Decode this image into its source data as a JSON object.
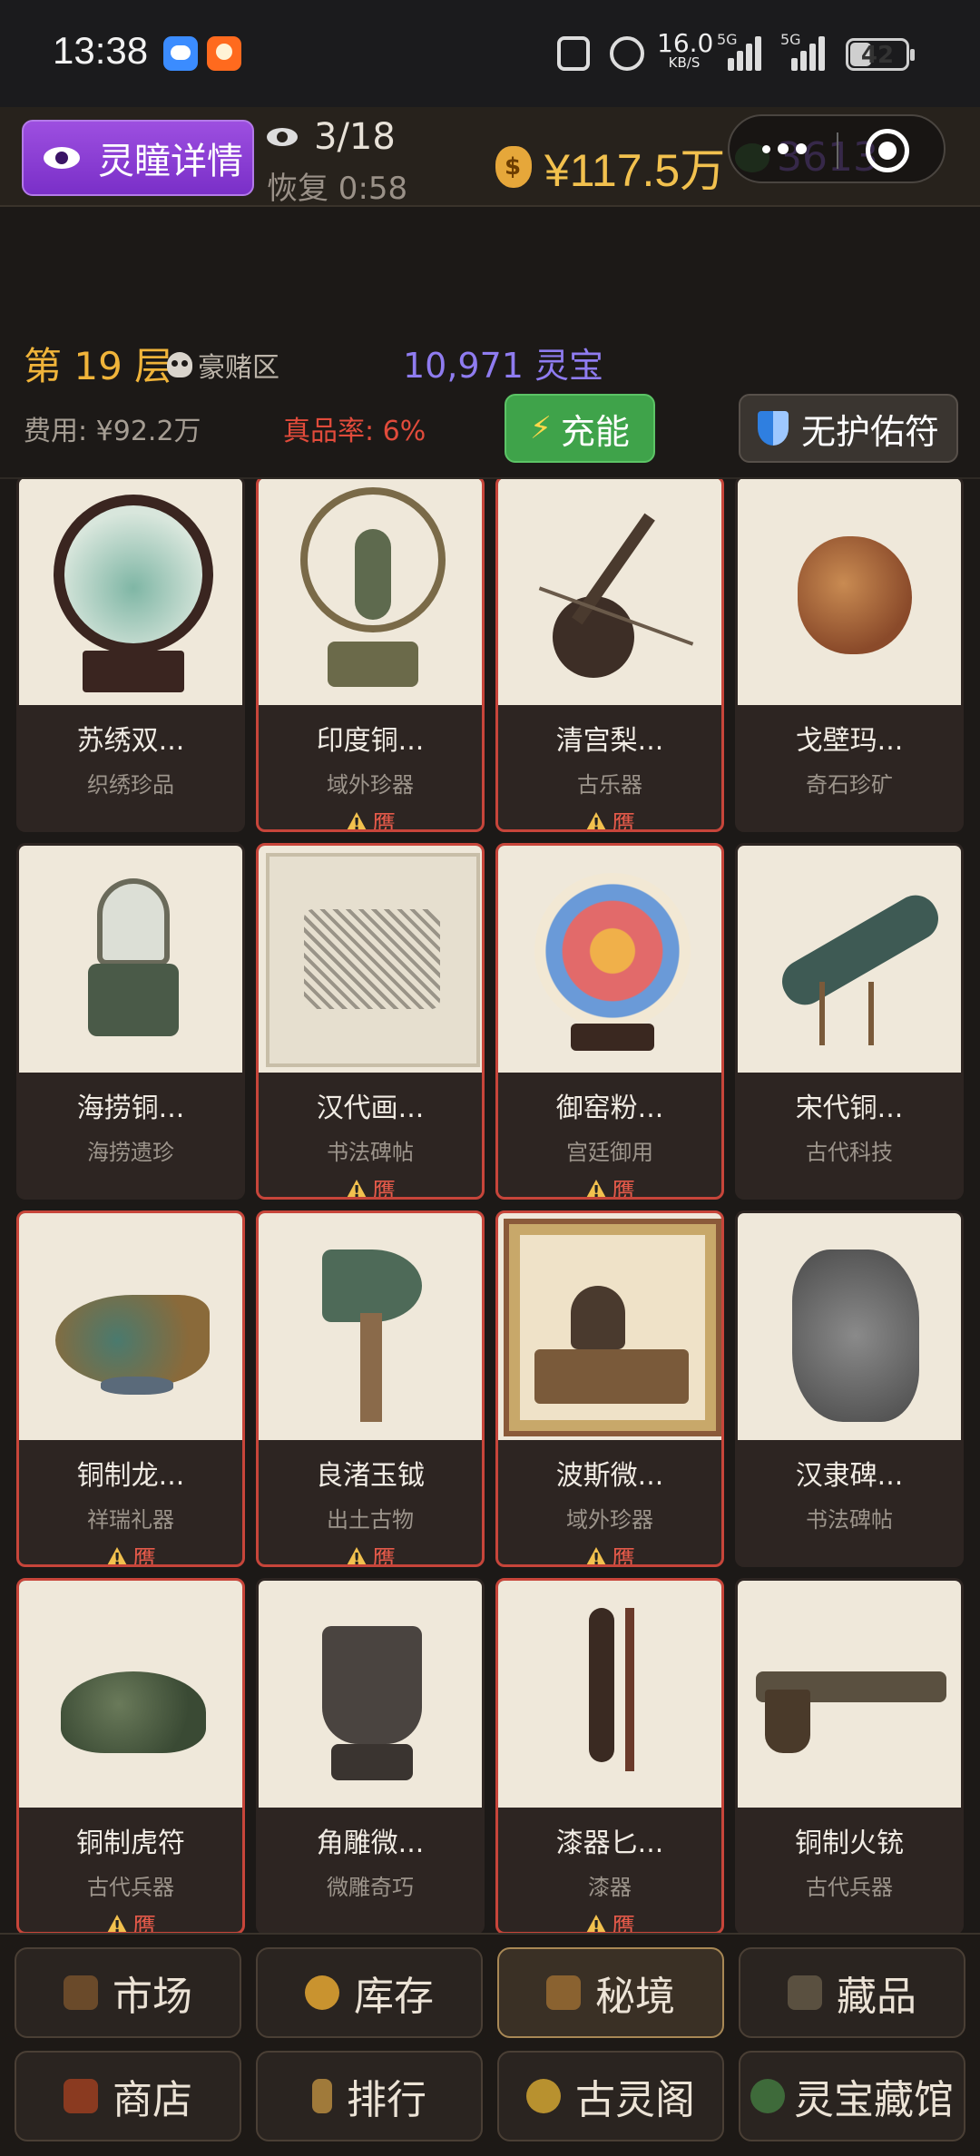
{
  "status_bar": {
    "time": "13:38",
    "net_speed_value": "16.0",
    "net_speed_unit": "KB/S",
    "signal1_tag": "5G",
    "signal2_tag": "5G",
    "battery": "42"
  },
  "header": {
    "eye_button_label": "灵瞳详情",
    "eye_count": "3/18",
    "recover_text": "恢复 0:58",
    "money": "¥117.5万",
    "gems": "3613"
  },
  "floor": {
    "floor_label": "第 19 层",
    "zone": "豪赌区",
    "lingbao": "10,971 灵宝",
    "cost": "费用: ¥92.2万",
    "rate": "真品率: 6%",
    "charge_label": "充能",
    "protect_label": "无护佑符"
  },
  "items": [
    {
      "name": "苏绣双...",
      "category": "织绣珍品",
      "fake": false,
      "warn": ""
    },
    {
      "name": "印度铜...",
      "category": "域外珍器",
      "fake": true,
      "warn": "赝"
    },
    {
      "name": "清宫梨...",
      "category": "古乐器",
      "fake": true,
      "warn": "赝"
    },
    {
      "name": "戈壁玛...",
      "category": "奇石珍矿",
      "fake": false,
      "warn": ""
    },
    {
      "name": "海捞铜...",
      "category": "海捞遗珍",
      "fake": false,
      "warn": ""
    },
    {
      "name": "汉代画...",
      "category": "书法碑帖",
      "fake": true,
      "warn": "赝"
    },
    {
      "name": "御窑粉...",
      "category": "宫廷御用",
      "fake": true,
      "warn": "赝"
    },
    {
      "name": "宋代铜...",
      "category": "古代科技",
      "fake": false,
      "warn": ""
    },
    {
      "name": "铜制龙...",
      "category": "祥瑞礼器",
      "fake": true,
      "warn": "赝"
    },
    {
      "name": "良渚玉钺",
      "category": "出土古物",
      "fake": true,
      "warn": "赝"
    },
    {
      "name": "波斯微...",
      "category": "域外珍器",
      "fake": true,
      "warn": "赝"
    },
    {
      "name": "汉隶碑...",
      "category": "书法碑帖",
      "fake": false,
      "warn": ""
    },
    {
      "name": "铜制虎符",
      "category": "古代兵器",
      "fake": true,
      "warn": "赝"
    },
    {
      "name": "角雕微...",
      "category": "微雕奇巧",
      "fake": false,
      "warn": ""
    },
    {
      "name": "漆器匕...",
      "category": "漆器",
      "fake": true,
      "warn": "赝"
    },
    {
      "name": "铜制火铳",
      "category": "古代兵器",
      "fake": false,
      "warn": ""
    }
  ],
  "nav": {
    "market": "市场",
    "inventory": "库存",
    "secret_realm": "秘境",
    "collection": "藏品",
    "shop": "商店",
    "ranking": "排行",
    "pavilion": "古灵阁",
    "museum": "灵宝藏馆"
  },
  "colors": {
    "accent_purple": "#8a3fd6",
    "gold": "#f2c14e",
    "fake_border": "#c7453a",
    "charge_green": "#3fa34a"
  }
}
